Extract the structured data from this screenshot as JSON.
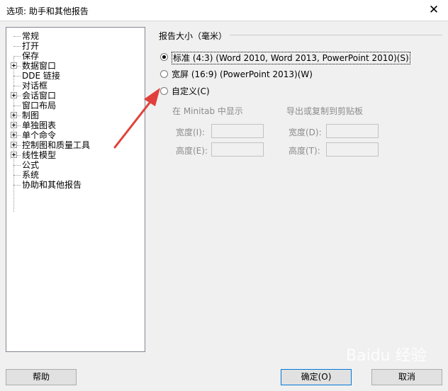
{
  "window": {
    "title": "选项: 助手和其他报告",
    "close_glyph": "✕"
  },
  "tree": {
    "items": [
      {
        "label": "常规",
        "expandable": false
      },
      {
        "label": "打开",
        "expandable": false
      },
      {
        "label": "保存",
        "expandable": false
      },
      {
        "label": "数据窗口",
        "expandable": true
      },
      {
        "label": "DDE 链接",
        "expandable": false
      },
      {
        "label": "对话框",
        "expandable": false
      },
      {
        "label": "会话窗口",
        "expandable": true
      },
      {
        "label": "窗口布局",
        "expandable": false
      },
      {
        "label": "制图",
        "expandable": true
      },
      {
        "label": "单独图表",
        "expandable": true
      },
      {
        "label": "单个命令",
        "expandable": true
      },
      {
        "label": "控制图和质量工具",
        "expandable": true
      },
      {
        "label": "线性模型",
        "expandable": true
      },
      {
        "label": "公式",
        "expandable": false
      },
      {
        "label": "系统",
        "expandable": false
      },
      {
        "label": "协助和其他报告",
        "expandable": false
      }
    ]
  },
  "report_size": {
    "group_title": "报告大小（毫米）",
    "options": [
      {
        "label": "标准 (4:3)  (Word 2010, Word 2013, PowerPoint 2010)(S)",
        "selected": true
      },
      {
        "label": "宽屏 (16:9)  (PowerPoint 2013)(W)",
        "selected": false
      },
      {
        "label": "自定义(C)",
        "selected": false
      }
    ],
    "minitab_display": {
      "heading": "在 Minitab 中显示",
      "width_label": "宽度(I):",
      "height_label": "高度(E):",
      "width_value": "",
      "height_value": ""
    },
    "export_copy": {
      "heading": "导出或复制到剪贴板",
      "width_label": "宽度(D):",
      "height_label": "高度(T):",
      "width_value": "",
      "height_value": ""
    }
  },
  "buttons": {
    "help": "帮助",
    "ok": "确定(O)",
    "cancel": "取消"
  },
  "annotation": {
    "arrow_color": "#e0403c"
  },
  "watermark": "Baidu 经验"
}
